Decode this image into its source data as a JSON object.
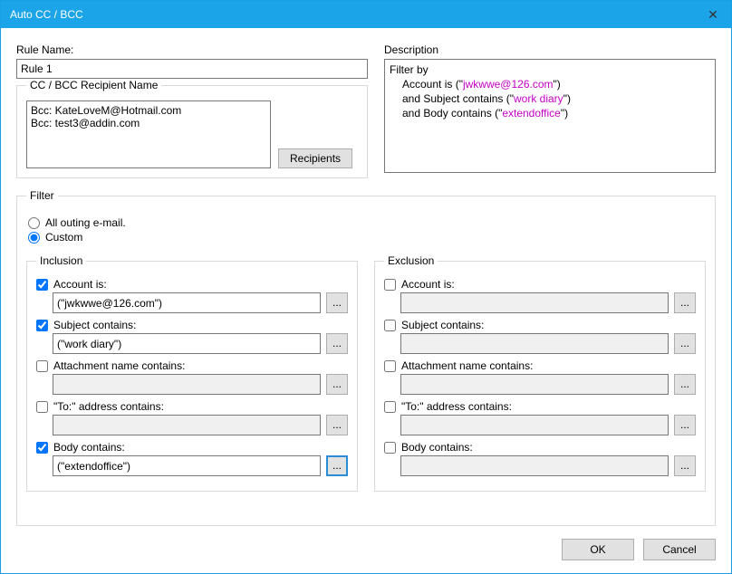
{
  "window": {
    "title": "Auto CC / BCC"
  },
  "ruleName": {
    "label": "Rule Name:",
    "value": "Rule 1"
  },
  "ccGroup": {
    "legend": "CC / BCC Recipient Name",
    "recipientsText": "Bcc: KateLoveM@Hotmail.com\nBcc: test3@addin.com",
    "recipientsButton": "Recipients"
  },
  "description": {
    "label": "Description",
    "line1a": "Filter by",
    "line2a": "Account is (\"",
    "line2v": "jwkwwe@126.com",
    "line2b": "\")",
    "line3a": "and Subject contains (\"",
    "line3v": "work diary",
    "line3b": "\")",
    "line4a": "and Body contains (\"",
    "line4v": "extendoffice",
    "line4b": "\")"
  },
  "filter": {
    "legend": "Filter",
    "allOuting": "All outing e-mail.",
    "custom": "Custom"
  },
  "inclusion": {
    "legend": "Inclusion",
    "account": {
      "label": "Account is:",
      "value": "(\"jwkwwe@126.com\")"
    },
    "subject": {
      "label": "Subject contains:",
      "value": "(\"work diary\")"
    },
    "attachment": {
      "label": "Attachment name contains:",
      "value": ""
    },
    "to": {
      "label": "\"To:\" address contains:",
      "value": ""
    },
    "body": {
      "label": "Body contains:",
      "value": "(\"extendoffice\")"
    }
  },
  "exclusion": {
    "legend": "Exclusion",
    "account": {
      "label": "Account is:",
      "value": ""
    },
    "subject": {
      "label": "Subject contains:",
      "value": ""
    },
    "attachment": {
      "label": "Attachment name contains:",
      "value": ""
    },
    "to": {
      "label": "\"To:\" address contains:",
      "value": ""
    },
    "body": {
      "label": "Body contains:",
      "value": ""
    }
  },
  "ellipsis": "...",
  "footer": {
    "ok": "OK",
    "cancel": "Cancel"
  }
}
